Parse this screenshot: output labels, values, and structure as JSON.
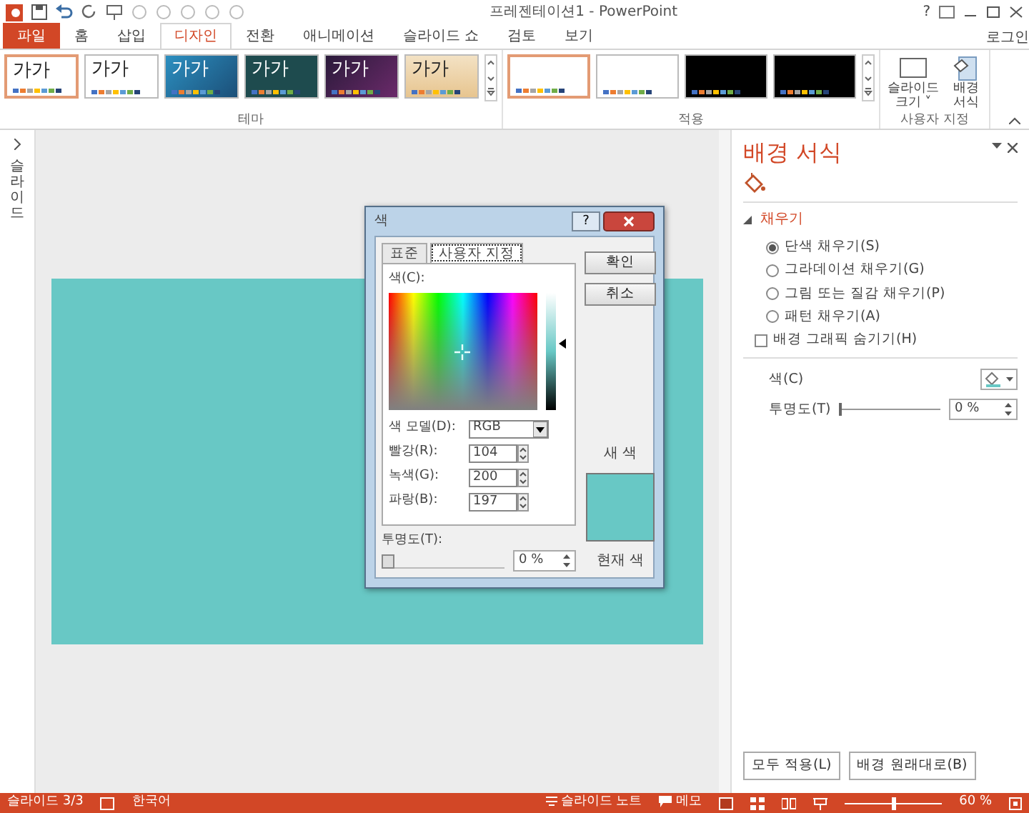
{
  "window": {
    "title": "프레젠테이션1 - PowerPoint",
    "help": "?"
  },
  "ribbon_tabs": [
    {
      "label": "파일",
      "kind": "file",
      "selected": false
    },
    {
      "label": "홈",
      "kind": "tab",
      "selected": false
    },
    {
      "label": "삽입",
      "kind": "tab",
      "selected": false
    },
    {
      "label": "디자인",
      "kind": "tab",
      "selected": true
    },
    {
      "label": "전환",
      "kind": "tab",
      "selected": false
    },
    {
      "label": "애니메이션",
      "kind": "tab",
      "selected": false
    },
    {
      "label": "슬라이드 쇼",
      "kind": "tab",
      "selected": false
    },
    {
      "label": "검토",
      "kind": "tab",
      "selected": false
    },
    {
      "label": "보기",
      "kind": "tab",
      "selected": false
    }
  ],
  "sign_in": "로그인",
  "themes": {
    "label": "테마",
    "items": [
      {
        "label": "가가",
        "kind": "white",
        "selected": true
      },
      {
        "label": "가가",
        "kind": "white",
        "selected": false
      },
      {
        "label": "가가",
        "kind": "blue",
        "selected": false
      },
      {
        "label": "가가",
        "kind": "teal",
        "selected": false
      },
      {
        "label": "가가",
        "kind": "purple",
        "selected": false
      },
      {
        "label": "가가",
        "kind": "beige",
        "selected": false
      }
    ]
  },
  "variants": {
    "label": "적용",
    "items": [
      {
        "kind": "white",
        "selected": true
      },
      {
        "kind": "white",
        "selected": false
      },
      {
        "kind": "black",
        "selected": false
      },
      {
        "kind": "black",
        "selected": false
      }
    ]
  },
  "customize": {
    "label": "사용자 지정",
    "buttons": [
      {
        "label": "슬라이드\n크기 ˅",
        "kind": "size"
      },
      {
        "label": "배경\n서식",
        "kind": "background"
      }
    ]
  },
  "thumbnail_pane": {
    "label": "슬라이드"
  },
  "slide": {
    "color": "#68c8c5"
  },
  "color_dialog": {
    "title": "색",
    "tabs": [
      {
        "label": "표준",
        "selected": false
      },
      {
        "label": "사용자 지정",
        "selected": true
      }
    ],
    "colors_label": "색(C):",
    "model_label": "색 모델(D):",
    "model": "RGB",
    "channels": [
      {
        "label": "빨강(R):",
        "value": "104"
      },
      {
        "label": "녹색(G):",
        "value": "200"
      },
      {
        "label": "파랑(B):",
        "value": "197"
      }
    ],
    "transparency_label": "투명도(T):",
    "transparency": {
      "level": 0,
      "value": "0 %"
    },
    "buttons": [
      "확인",
      "취소"
    ],
    "new_swatch": {
      "label": "새 색",
      "color": "#68c8c5"
    },
    "current_swatch": {
      "label": "현재 색",
      "color": "#68c8c5"
    }
  },
  "format_pane": {
    "title": "배경 서식",
    "section": {
      "label": "채우기",
      "expanded": true
    },
    "fill_options": [
      {
        "label": "단색 채우기(S)",
        "selected": true
      },
      {
        "label": "그라데이션 채우기(G)",
        "selected": false
      },
      {
        "label": "그림 또는 질감 채우기(P)",
        "selected": false
      },
      {
        "label": "패턴 채우기(A)",
        "selected": false
      }
    ],
    "hide_graphics": {
      "label": "배경 그래픽 숨기기(H)",
      "checked": false
    },
    "color_label": "색(C)",
    "transparency_label": "투명도(T)",
    "transparency": {
      "level": 0,
      "value": "0 %"
    },
    "buttons": [
      "모두 적용(L)",
      "배경 원래대로(B)"
    ]
  },
  "status_bar": {
    "slide": "슬라이드 3/3",
    "language": "한국어",
    "notes": "슬라이드 노트",
    "comments": "메모",
    "zoom": {
      "value": "60 %",
      "level": 0.5
    }
  }
}
